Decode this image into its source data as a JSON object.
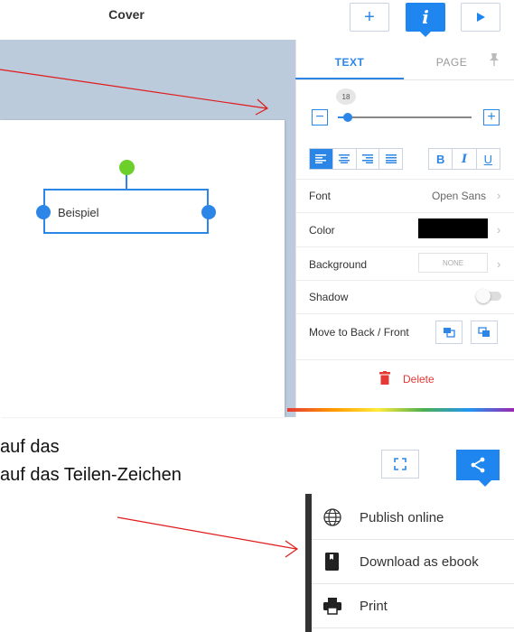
{
  "editor": {
    "title": "Cover",
    "toolbar": {
      "add_icon": "plus-icon",
      "info_label": "i",
      "play_icon": "play-icon"
    },
    "canvas": {
      "textbox_text": "Beispiel"
    },
    "panel": {
      "tabs": [
        {
          "label": "TEXT",
          "active": true
        },
        {
          "label": "PAGE",
          "active": false
        }
      ],
      "font_size": "18",
      "font_size_min_label": "−",
      "font_size_plus_label": "+",
      "align_buttons": [
        "align-left",
        "align-center",
        "align-right",
        "align-justify"
      ],
      "format_buttons": [
        "B",
        "I",
        "U"
      ],
      "rows": {
        "font_label": "Font",
        "font_value": "Open Sans",
        "color_label": "Color",
        "color_value": "#000000",
        "background_label": "Background",
        "background_value": "NONE",
        "shadow_label": "Shadow",
        "order_label": "Move to Back / Front"
      },
      "delete_label": "Delete"
    }
  },
  "notes": {
    "line1": "auf das",
    "line2": "auf das Teilen-Zeichen"
  },
  "share": {
    "menu": [
      {
        "icon": "globe-icon",
        "label": "Publish online"
      },
      {
        "icon": "book-icon",
        "label": "Download as ebook"
      },
      {
        "icon": "printer-icon",
        "label": "Print"
      }
    ]
  },
  "colors": {
    "accent": "#1f86f0",
    "canvas_bg": "#bccbdc",
    "rotate_handle": "#6ccf2a",
    "delete": "#e53935",
    "annotation_arrow": "#e01b1b"
  }
}
